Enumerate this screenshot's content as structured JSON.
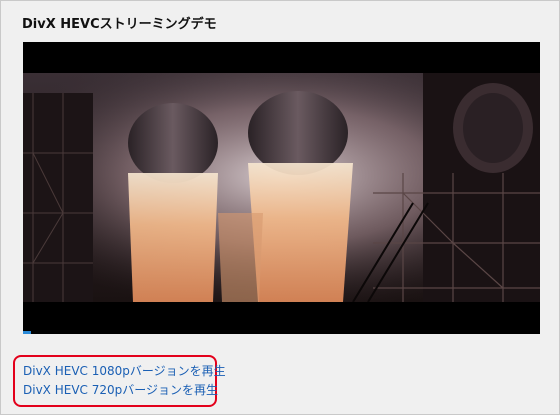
{
  "page": {
    "title": "DivX HEVCストリーミングデモ"
  },
  "player": {
    "label": "video-player"
  },
  "links": [
    {
      "label": "DivX HEVC 1080pバージョンを再生"
    },
    {
      "label": "DivX HEVC 720pバージョンを再生"
    }
  ],
  "colors": {
    "link": "#1a5fb4",
    "highlight": "#e3001b",
    "background": "#f0f0f0"
  }
}
